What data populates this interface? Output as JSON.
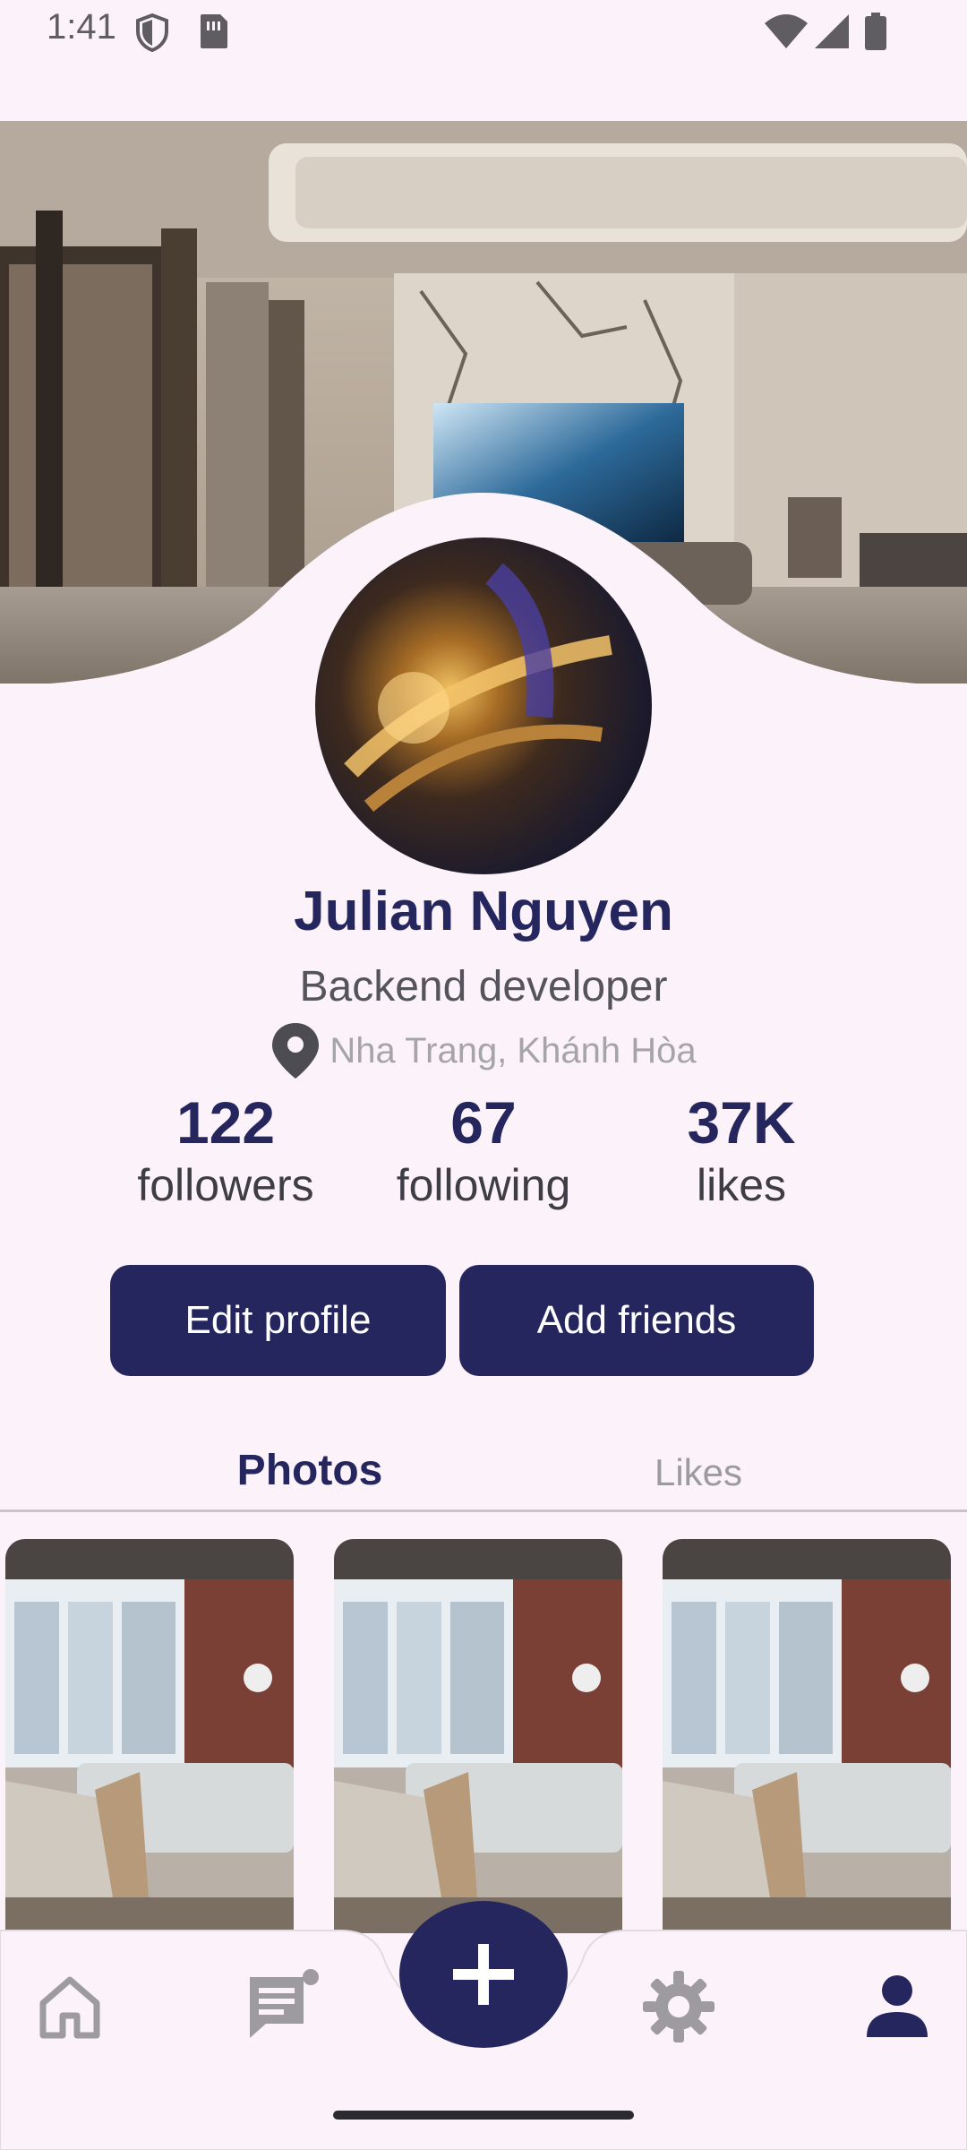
{
  "status_bar": {
    "time": "1:41"
  },
  "profile": {
    "name": "Julian Nguyen",
    "role": "Backend developer",
    "location": "Nha Trang, Khánh Hòa"
  },
  "stats": [
    {
      "value": "122",
      "label": "followers"
    },
    {
      "value": "67",
      "label": "following"
    },
    {
      "value": "37K",
      "label": "likes"
    }
  ],
  "actions": {
    "edit_profile": "Edit profile",
    "add_friends": "Add friends"
  },
  "tabs": {
    "photos": "Photos",
    "likes": "Likes",
    "active": "Photos"
  },
  "bottom_nav": {
    "items": [
      "home-icon",
      "feed-icon",
      "add-icon",
      "settings-icon",
      "profile-icon"
    ],
    "active": "profile-icon"
  },
  "colors": {
    "primary": "#25265e",
    "background": "#fcf3fa",
    "muted": "#a6a4ab"
  }
}
